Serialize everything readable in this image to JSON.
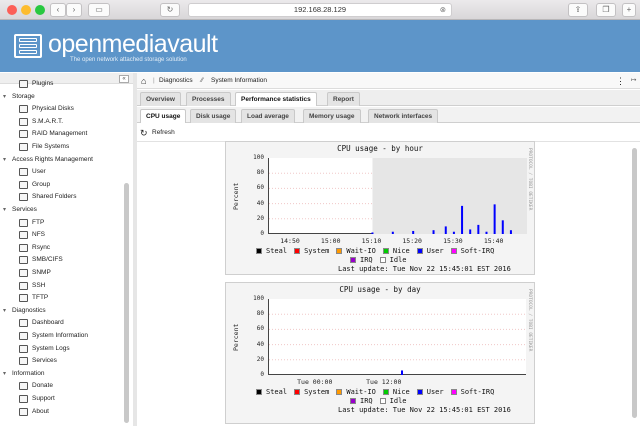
{
  "browser": {
    "url": "192.168.28.129",
    "traffic_colors": [
      "#fc5f57",
      "#fdbc2e",
      "#28c840"
    ]
  },
  "banner": {
    "brand": "openmediavault",
    "tagline": "The open network attached storage solution",
    "color": "#5d95c9"
  },
  "nav": {
    "groups": [
      {
        "label": null,
        "items": [
          {
            "label": "Plugins",
            "icon": "plugin-icon"
          }
        ]
      },
      {
        "label": "Storage",
        "items": [
          {
            "label": "Physical Disks",
            "icon": "disk-icon"
          },
          {
            "label": "S.M.A.R.T.",
            "icon": "smart-icon"
          },
          {
            "label": "RAID Management",
            "icon": "raid-icon"
          },
          {
            "label": "File Systems",
            "icon": "filesystem-icon"
          }
        ]
      },
      {
        "label": "Access Rights Management",
        "items": [
          {
            "label": "User",
            "icon": "user-icon"
          },
          {
            "label": "Group",
            "icon": "group-icon"
          },
          {
            "label": "Shared Folders",
            "icon": "share-icon"
          }
        ]
      },
      {
        "label": "Services",
        "items": [
          {
            "label": "FTP",
            "icon": "ftp-icon"
          },
          {
            "label": "NFS",
            "icon": "nfs-icon"
          },
          {
            "label": "Rsync",
            "icon": "rsync-icon"
          },
          {
            "label": "SMB/CIFS",
            "icon": "smb-icon"
          },
          {
            "label": "SNMP",
            "icon": "snmp-icon"
          },
          {
            "label": "SSH",
            "icon": "ssh-icon"
          },
          {
            "label": "TFTP",
            "icon": "tftp-icon"
          }
        ]
      },
      {
        "label": "Diagnostics",
        "items": [
          {
            "label": "Dashboard",
            "icon": "dashboard-icon"
          },
          {
            "label": "System Information",
            "icon": "system-info-icon"
          },
          {
            "label": "System Logs",
            "icon": "logs-icon"
          },
          {
            "label": "Services",
            "icon": "services-icon"
          }
        ]
      },
      {
        "label": "Information",
        "items": [
          {
            "label": "Donate",
            "icon": "heart-icon"
          },
          {
            "label": "Support",
            "icon": "support-icon"
          },
          {
            "label": "About",
            "icon": "about-icon"
          }
        ]
      }
    ]
  },
  "breadcrumb": {
    "part1": "Diagnostics",
    "part2": "System Information"
  },
  "tabs": [
    "Overview",
    "Processes",
    "Performance statistics",
    "Report"
  ],
  "subtabs": [
    "CPU usage",
    "Disk usage",
    "Load average",
    "Memory usage",
    "Network interfaces"
  ],
  "toolbar": {
    "refresh": "Refresh"
  },
  "side_text": "PROTOCOL / TOBI OETIKER",
  "chart_data": [
    {
      "type": "area",
      "title": "CPU usage - by hour",
      "ylabel": "Percent",
      "ylim": [
        0,
        100
      ],
      "yticks": [
        "100",
        "80",
        "60",
        "40",
        "20",
        "0"
      ],
      "xticks": [
        "14:50",
        "15:00",
        "15:10",
        "15:20",
        "15:30",
        "15:40"
      ],
      "legend": [
        "Steal",
        "System",
        "Wait-IO",
        "Nice",
        "User",
        "Soft-IRQ",
        "IRQ",
        "Idle"
      ],
      "legend_colors": [
        "#000000",
        "#ff0000",
        "#ff9900",
        "#00cc00",
        "#0000ff",
        "#ff00ff",
        "#9900cc",
        "#ffffff"
      ],
      "footer": "Last update: Tue Nov 22 15:45:01 EST 2016",
      "series": [
        {
          "name": "User",
          "x": [
            "15:10",
            "15:15",
            "15:20",
            "15:25",
            "15:28",
            "15:30",
            "15:32",
            "15:34",
            "15:36",
            "15:38",
            "15:40",
            "15:42",
            "15:44"
          ],
          "values": [
            2,
            3,
            4,
            5,
            10,
            3,
            37,
            6,
            12,
            3,
            39,
            18,
            5
          ]
        }
      ]
    },
    {
      "type": "area",
      "title": "CPU usage - by day",
      "ylabel": "Percent",
      "ylim": [
        0,
        100
      ],
      "yticks": [
        "100",
        "80",
        "60",
        "40",
        "20",
        "0"
      ],
      "xticks": [
        "Tue 00:00",
        "Tue 12:00"
      ],
      "legend": [
        "Steal",
        "System",
        "Wait-IO",
        "Nice",
        "User",
        "Soft-IRQ",
        "IRQ",
        "Idle"
      ],
      "legend_colors": [
        "#000000",
        "#ff0000",
        "#ff9900",
        "#00cc00",
        "#0000ff",
        "#ff00ff",
        "#9900cc",
        "#ffffff"
      ],
      "footer": "Last update: Tue Nov 22 15:45:01 EST 2016",
      "series": [
        {
          "name": "User",
          "x": [
            "Tue 15:00"
          ],
          "values": [
            6
          ]
        }
      ]
    }
  ]
}
